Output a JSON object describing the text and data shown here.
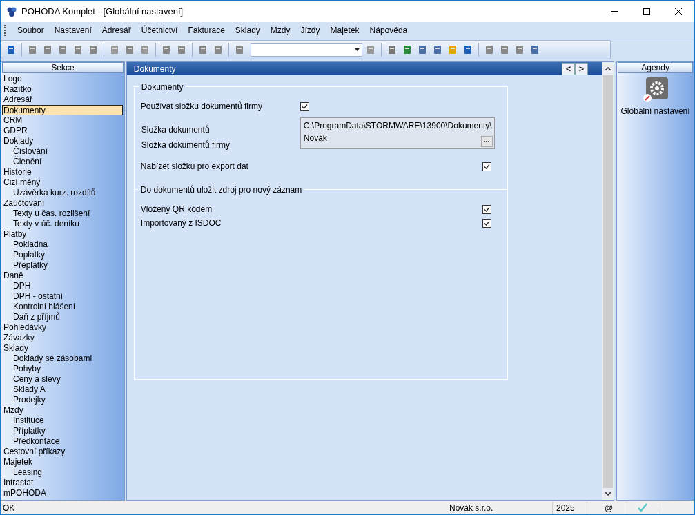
{
  "window": {
    "title": "POHODA Komplet - [Globální nastavení]"
  },
  "menu": [
    "Soubor",
    "Nastavení",
    "Adresář",
    "Účetnictví",
    "Fakturace",
    "Sklady",
    "Mzdy",
    "Jízdy",
    "Majetek",
    "Nápověda"
  ],
  "sidebar": {
    "title": "Sekce",
    "items": [
      {
        "label": "Logo",
        "selected": false
      },
      {
        "label": "Razítko",
        "selected": false
      },
      {
        "label": "Adresář",
        "selected": false
      },
      {
        "label": "Dokumenty",
        "selected": true
      },
      {
        "label": "CRM",
        "selected": false
      },
      {
        "label": "GDPR",
        "selected": false
      },
      {
        "label": "Doklady",
        "selected": false,
        "children": [
          {
            "label": "Číslování",
            "selected": false
          },
          {
            "label": "Členění",
            "selected": false
          }
        ]
      },
      {
        "label": "Historie",
        "selected": false
      },
      {
        "label": "Cizí měny",
        "selected": false,
        "children": [
          {
            "label": "Uzávěrka kurz. rozdílů",
            "selected": false
          }
        ]
      },
      {
        "label": "Zaúčtování",
        "selected": false,
        "children": [
          {
            "label": "Texty u čas. rozlišení",
            "selected": false
          },
          {
            "label": "Texty v úč. deníku",
            "selected": false
          }
        ]
      },
      {
        "label": "Platby",
        "selected": false,
        "children": [
          {
            "label": "Pokladna",
            "selected": false
          },
          {
            "label": "Poplatky",
            "selected": false
          },
          {
            "label": "Přeplatky",
            "selected": false
          }
        ]
      },
      {
        "label": "Daně",
        "selected": false,
        "children": [
          {
            "label": "DPH",
            "selected": false
          },
          {
            "label": "DPH - ostatní",
            "selected": false
          },
          {
            "label": "Kontrolní hlášení",
            "selected": false
          },
          {
            "label": "Daň z příjmů",
            "selected": false
          }
        ]
      },
      {
        "label": "Pohledávky",
        "selected": false
      },
      {
        "label": "Závazky",
        "selected": false
      },
      {
        "label": "Sklady",
        "selected": false,
        "children": [
          {
            "label": "Doklady se zásobami",
            "selected": false
          },
          {
            "label": "Pohyby",
            "selected": false
          },
          {
            "label": "Ceny a slevy",
            "selected": false
          },
          {
            "label": "Sklady A",
            "selected": false
          },
          {
            "label": "Prodejky",
            "selected": false
          }
        ]
      },
      {
        "label": "Mzdy",
        "selected": false,
        "children": [
          {
            "label": "Instituce",
            "selected": false
          },
          {
            "label": "Příplatky",
            "selected": false
          },
          {
            "label": "Předkontace",
            "selected": false
          }
        ]
      },
      {
        "label": "Cestovní příkazy",
        "selected": false
      },
      {
        "label": "Majetek",
        "selected": false,
        "children": [
          {
            "label": "Leasing",
            "selected": false
          }
        ]
      },
      {
        "label": "Intrastat",
        "selected": false
      },
      {
        "label": "mPOHODA",
        "selected": false
      }
    ]
  },
  "content": {
    "title": "Dokumenty",
    "prev": "<",
    "next": ">",
    "group": {
      "title": "Dokumenty",
      "use_company_folder": {
        "label": "Používat složku dokumentů firmy",
        "checked": true
      },
      "folder_labels": [
        "Složka dokumentů",
        "Složka dokumentů firmy"
      ],
      "folder_value": "C:\\ProgramData\\STORMWARE\\13900\\Dokumenty\\",
      "company_value": "Novák",
      "browse": "···",
      "offer_export": {
        "label": "Nabízet složku pro export dat",
        "checked": true
      }
    },
    "group2": {
      "title": "Do dokumentů uložit zdroj pro nový záznam",
      "options": [
        {
          "label": "Vložený QR kódem",
          "checked": true
        },
        {
          "label": "Importovaný z ISDOC",
          "checked": true
        }
      ]
    }
  },
  "agendy": {
    "title": "Agendy",
    "items": [
      {
        "label": "Globální nastavení"
      }
    ]
  },
  "status_bar": {
    "message": "OK",
    "company": "Novák s.r.o.",
    "year": "2025",
    "at": "@"
  }
}
